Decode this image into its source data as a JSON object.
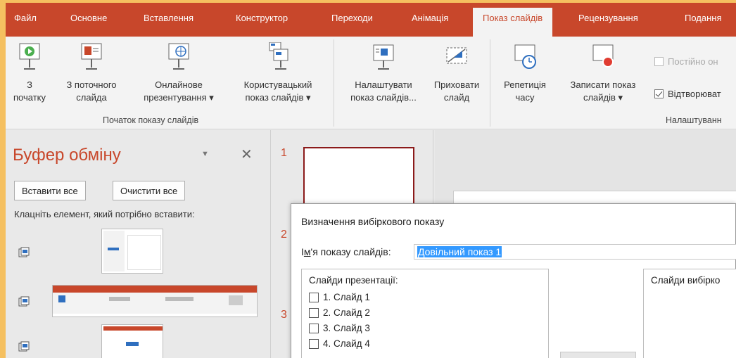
{
  "ribbon_tabs": [
    {
      "label": "Файл"
    },
    {
      "label": "Основне"
    },
    {
      "label": "Вставлення"
    },
    {
      "label": "Конструктор"
    },
    {
      "label": "Переходи"
    },
    {
      "label": "Анімація"
    },
    {
      "label": "Показ слайдів",
      "active": true
    },
    {
      "label": "Рецензування"
    },
    {
      "label": "Подання"
    }
  ],
  "ribbon": {
    "btn_from_start_line1": "З",
    "btn_from_start_line2": "початку",
    "btn_from_current_line1": "З поточного",
    "btn_from_current_line2": "слайда",
    "btn_online_line1": "Онлайнове",
    "btn_online_line2": "презентування ▾",
    "btn_custom_line1": "Користувацький",
    "btn_custom_line2": "показ слайдів ▾",
    "group_start_label": "Початок показу слайдів",
    "btn_setup_line1": "Налаштувати",
    "btn_setup_line2": "показ слайдів...",
    "btn_hide_line1": "Приховати",
    "btn_hide_line2": "слайд",
    "btn_rehearse_line1": "Репетиція",
    "btn_rehearse_line2": "часу",
    "btn_record_line1": "Записати показ",
    "btn_record_line2": "слайдів ▾",
    "chk_loop_label": "Постійно он",
    "chk_play_label": "Відтворюват",
    "group_setup_label": "Налаштуванн"
  },
  "clipboard": {
    "title": "Буфер обміну",
    "paste_all": "Вставити все",
    "clear_all": "Очистити все",
    "hint": "Клацніть елемент, який потрібно вставити:"
  },
  "slide_numbers": [
    "1",
    "2",
    "3"
  ],
  "dialog": {
    "title": "Визначення вибіркового показу",
    "name_label_prefix": "І",
    "name_label_accel": "м",
    "name_label_rest": "'я показу слайдів:",
    "name_value": "Довільний показ 1",
    "left_list_header": "Слайди презентації:",
    "right_list_header": "Слайди вибірко",
    "slides": [
      "1. Слайд 1",
      "2. Слайд 2",
      "3. Слайд 3",
      "4. Слайд 4"
    ]
  },
  "colors": {
    "accent": "#c8472b",
    "border_frame": "#f5c060",
    "selection": "#3399ff"
  }
}
